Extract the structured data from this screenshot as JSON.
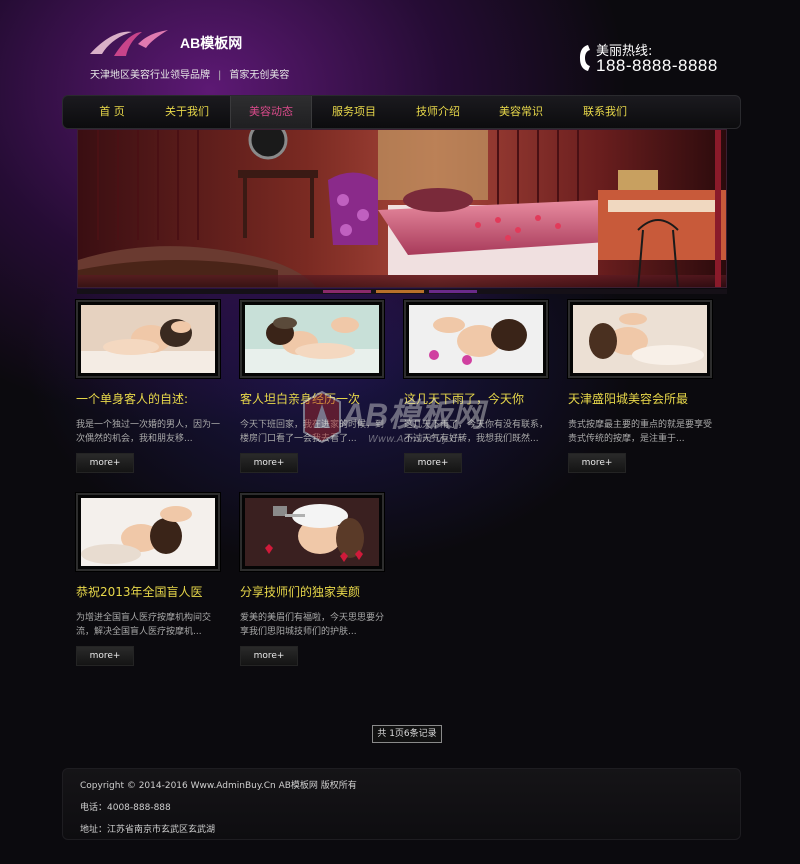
{
  "header": {
    "logo_text": "AB模板网",
    "slogan": "天津地区美容行业领导品牌",
    "slogan2": "首家无创美容",
    "hotline_label": "美丽热线:",
    "hotline_number": "188-8888-8888",
    "phone_icon": "phone-icon"
  },
  "nav": {
    "items": [
      {
        "label": "首  页"
      },
      {
        "label": "关于我们"
      },
      {
        "label": "美容动态",
        "active": true
      },
      {
        "label": "服务项目"
      },
      {
        "label": "技师介绍"
      },
      {
        "label": "美容常识"
      },
      {
        "label": "联系我们"
      }
    ]
  },
  "banner": {
    "dot_colors": [
      "#8a2a6a",
      "#b8702a",
      "#6a2a8a"
    ]
  },
  "cards": [
    {
      "title": "一个单身客人的自述:",
      "excerpt": "我是一个独过一次婚的男人，因为一次偶然的机会，我和朋友移...",
      "more": "more+"
    },
    {
      "title": "客人坦白亲身经历一次",
      "excerpt": "今天下班回家，我在进家的时候，到楼房门口看了一会我去看了...",
      "more": "more+"
    },
    {
      "title": "这几天下雨了，今天你",
      "excerpt": "这几天下雨了，今天你有没有联系，不过天气有好转，我想我们既然...",
      "more": "more+"
    },
    {
      "title": "天津盛阳城美容会所最",
      "excerpt": "贵式按摩最主要的重点的就是要享受贵式传统的按摩，是注重于...",
      "more": "more+"
    },
    {
      "title": "恭祝2013年全国盲人医",
      "excerpt": "为增进全国盲人医疗按摩机构间交流，解决全国盲人医疗按摩机...",
      "more": "more+"
    },
    {
      "title": "分享技师们的独家美颜",
      "excerpt": "爱美的美眉们有福啦，今天思思要分享我们思阳城技师们的护肤...",
      "more": "more+"
    }
  ],
  "pager": {
    "text": "共 1页6条记录"
  },
  "footer": {
    "copyright": "Copyright © 2014-2016 Www.AdminBuy.Cn AB模板网 版权所有",
    "phone": "电话：4008-888-888",
    "address": "地址：江苏省南京市玄武区玄武湖"
  },
  "watermark": {
    "text": "AB模板网",
    "url": "Www.AdminBuy.Cn"
  },
  "colors": {
    "accent_yellow": "#e8d84a",
    "active_nav": "#d84a8a",
    "purple_glow": "#7a1e96"
  }
}
